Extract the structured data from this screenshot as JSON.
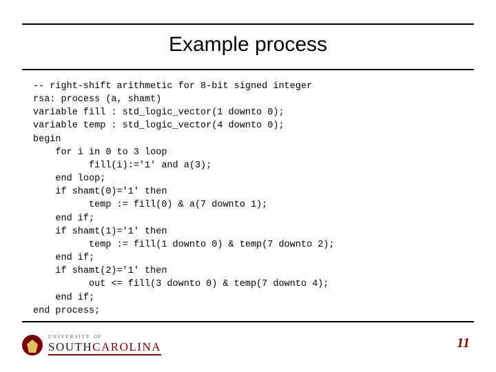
{
  "title": "Example process",
  "code": "-- right-shift arithmetic for 8-bit signed integer\nrsa: process (a, shamt)\nvariable fill : std_logic_vector(1 downto 0);\nvariable temp : std_logic_vector(4 downto 0);\nbegin\n    for i in 0 to 3 loop\n          fill(i):='1' and a(3);\n    end loop;\n    if shamt(0)='1' then\n          temp := fill(0) & a(7 downto 1);\n    end if;\n    if shamt(1)='1' then\n          temp := fill(1 downto 0) & temp(7 downto 2);\n    end if;\n    if shamt(2)='1' then\n          out <= fill(3 downto 0) & temp(7 downto 4);\n    end if;\nend process;",
  "footer": {
    "university_line": "UNIVERSITY OF",
    "south": "SOUTH",
    "carolina": "CAROLINA"
  },
  "page_number": "11"
}
